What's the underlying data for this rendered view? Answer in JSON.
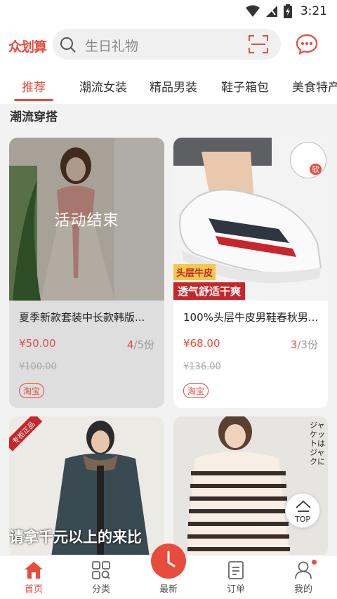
{
  "status": {
    "time": "3:21"
  },
  "header": {
    "logo": "众划算",
    "search_placeholder": "生日礼物"
  },
  "tabs": [
    {
      "label": "推荐",
      "active": true
    },
    {
      "label": "潮流女装"
    },
    {
      "label": "精品男装"
    },
    {
      "label": "鞋子箱包"
    },
    {
      "label": "美食特产"
    }
  ],
  "section": {
    "title": "潮流穿搭"
  },
  "products": [
    {
      "title": "夏季新款套装中长款韩版...",
      "price": "¥50.00",
      "stock_current": "4",
      "stock_total": "/5份",
      "original_price": "¥100.00",
      "tag": "淘宝",
      "overlay": "活动结束"
    },
    {
      "title": "100%头层牛皮男鞋春秋男...",
      "price": "¥68.00",
      "stock_current": "3",
      "stock_total": "/3份",
      "original_price": "¥136.00",
      "tag": "淘宝",
      "img_badge": "软",
      "img_caption1": "头层牛皮",
      "img_caption2": "透气舒适干爽"
    },
    {
      "img_caption": "请拿千元以上的来比",
      "img_corner": "专柜正品"
    },
    {
      "img_caption": "ジャケットはジャクに"
    }
  ],
  "top_button": {
    "label": "TOP"
  },
  "bottom_nav": [
    {
      "label": "首页",
      "active": true
    },
    {
      "label": "分类"
    },
    {
      "label": "最新"
    },
    {
      "label": "订单"
    },
    {
      "label": "我的"
    }
  ],
  "colors": {
    "accent": "#e84c3d"
  }
}
